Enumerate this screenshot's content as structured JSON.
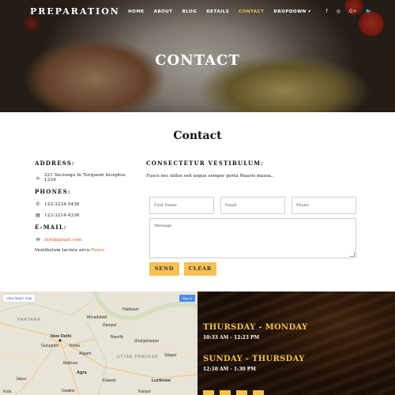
{
  "header": {
    "logo": "PREPARATION",
    "nav": [
      "HOME",
      "ABOUT",
      "BLOG",
      "DETAILS",
      "CONTACT",
      "DROPDOWN"
    ],
    "dropdown_caret": "▾",
    "active": "CONTACT",
    "social": [
      "f",
      "◎",
      "G+",
      "🐦"
    ]
  },
  "hero": {
    "title": "CONTACT"
  },
  "contact": {
    "title": "Contact",
    "address_label": "ADDRESS:",
    "address": "321 Sociosqu In Torquent Inceptos 1234",
    "phones_label": "PHONES:",
    "phone1": "123-3234-5436",
    "phone2": "123-3214-4336",
    "email_label": "E-MAIL:",
    "email": "info@gmail.com",
    "extra_prefix": "Vestibulum lacinia arcu:",
    "extra_link": "Fusce",
    "right_label": "CONSECTETUR VESTIBULUM:",
    "description": "Fusce nec tellus sed augue semper porta Mauris massa..",
    "form": {
      "first_name_placeholder": "First Name",
      "email_placeholder": "Email",
      "phone_placeholder": "Phone",
      "message_placeholder": "Message",
      "send_label": "SEND",
      "clear_label": "CLEAR"
    }
  },
  "map": {
    "view_larger": "View larger map",
    "sign_in": "Sign in",
    "places": [
      "HARYANA",
      "New Delhi",
      "Gurugram",
      "Noida",
      "Jaipur",
      "Agra",
      "Gwalior",
      "UTTAR PRADESH",
      "Bareilly",
      "Lucknow",
      "Kanpur",
      "Moradabad",
      "Aligarh",
      "Rampur",
      "Haldwani",
      "Shahjahanpur",
      "Sitapur",
      "Mathura",
      "Etawah",
      "Kota"
    ]
  },
  "hours": {
    "day1": "THURSDAY - MONDAY",
    "time1": "10:33 AM - 12:23 PM",
    "day2": "SUNDAY - THURSDAY",
    "time2": "12:10 AM - 1:30 PM"
  },
  "colors": {
    "accent": "#f7c052",
    "active_nav": "#f7c44a",
    "link_red": "#e74b32"
  }
}
